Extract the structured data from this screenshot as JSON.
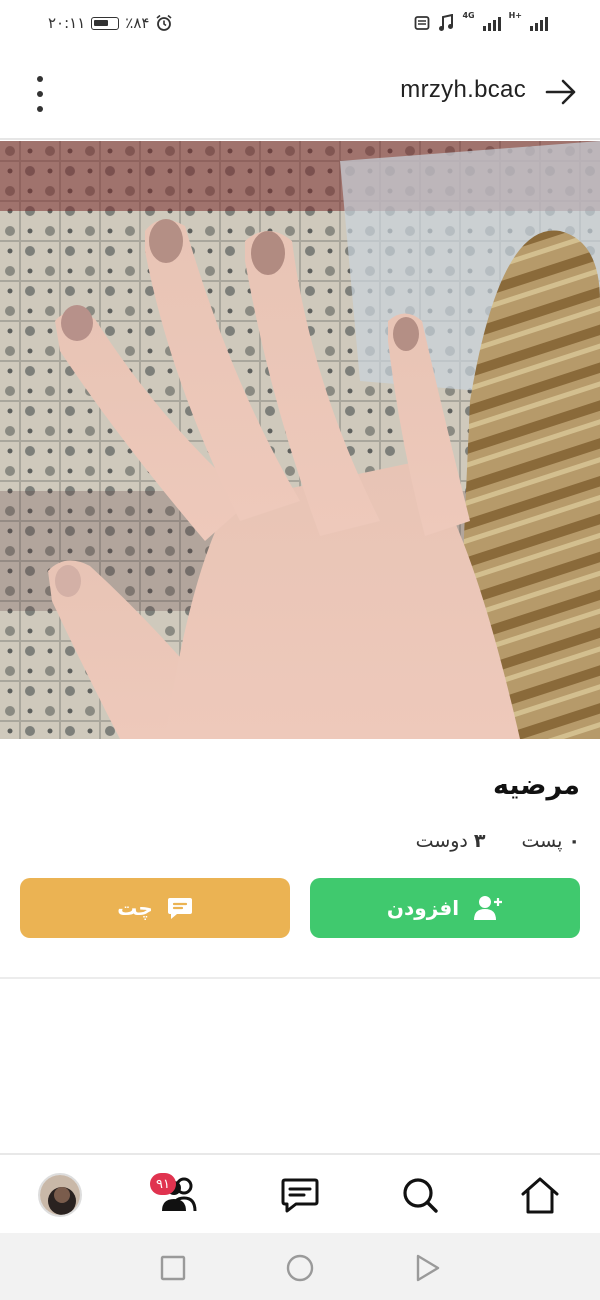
{
  "status_bar": {
    "time": "۲۰:۱۱",
    "battery": "٪۸۴",
    "network_tag_1": "4G",
    "network_tag_2": "H+"
  },
  "header": {
    "username": "mrzyh.bcac"
  },
  "profile": {
    "display_name": "مرضیه",
    "posts_count": "۰",
    "posts_label": "پست",
    "friends_count": "۳",
    "friends_label": "دوست"
  },
  "actions": {
    "add_label": "افزودن",
    "chat_label": "چت",
    "add_color": "#40c96e",
    "chat_color": "#ebb353"
  },
  "bottom_nav": {
    "friends_badge": "۹۱",
    "items": [
      "avatar",
      "friends-icon",
      "messages-icon",
      "search-icon",
      "home-icon"
    ]
  },
  "colors": {
    "badge": "#e0334f"
  }
}
